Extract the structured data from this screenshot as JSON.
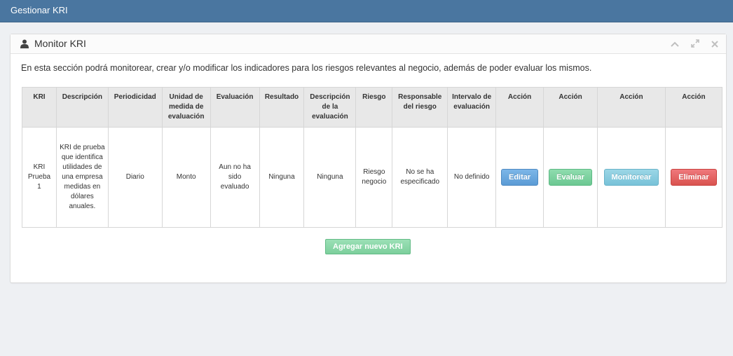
{
  "topbar": {
    "title": "Gestionar KRI"
  },
  "panel": {
    "title": "Monitor KRI",
    "icons": [
      "user-icon",
      "chevron-up-icon",
      "expand-icon",
      "close-icon"
    ],
    "intro": "En esta sección podrá monitorear, crear y/o modificar los indicadores para los riesgos relevantes al negocio, además de poder evaluar los mismos."
  },
  "table": {
    "headers": [
      "KRI",
      "Descripción",
      "Periodicidad",
      "Unidad de medida de evaluación",
      "Evaluación",
      "Resultado",
      "Descripción de la evaluación",
      "Riesgo",
      "Responsable del riesgo",
      "Intervalo de evaluación",
      "Acción",
      "Acción",
      "Acción",
      "Acción"
    ],
    "rows": [
      {
        "kri": "KRI Prueba 1",
        "descripcion": "KRI de prueba que identifica utilidades de una empresa medidas en dólares anuales.",
        "periodicidad": "Diario",
        "unidad": "Monto",
        "evaluacion": "Aun no ha sido evaluado",
        "resultado": "Ninguna",
        "descripcion_eval": "Ninguna",
        "riesgo": "Riesgo negocio",
        "responsable": "No se ha especificado",
        "intervalo": "No definido",
        "actions": {
          "edit": "Editar",
          "evaluate": "Evaluar",
          "monitor": "Monitorear",
          "delete": "Eliminar"
        }
      }
    ]
  },
  "add_button": "Agregar nuevo KRI",
  "colors": {
    "topbar": "#4a76a0",
    "edit": "#5b9bd5",
    "evaluate": "#6cc892",
    "monitor": "#78c2d8",
    "delete": "#d9534f"
  }
}
